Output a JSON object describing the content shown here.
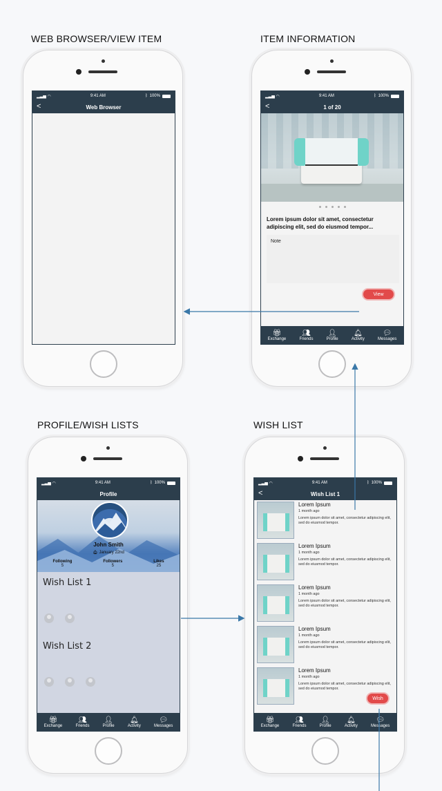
{
  "labels": {
    "browser": "WEB BROWSER/VIEW ITEM",
    "item_info": "ITEM INFORMATION",
    "profile": "PROFILE/WISH LISTS",
    "wish_list": "WISH LIST"
  },
  "status": {
    "time": "9:41 AM",
    "battery": "100%"
  },
  "browser_screen": {
    "title": "Web Browser",
    "back": "<"
  },
  "item_screen": {
    "title": "1 of 20",
    "back": "<",
    "description": "Lorem ipsum dolor sit amet, consectetur adipiscing elit, sed do eiusmod tempor...",
    "note_label": "Note",
    "view_label": "View"
  },
  "tabs": [
    {
      "label": "Exchange",
      "icon": "gift-icon"
    },
    {
      "label": "Friends",
      "icon": "friends-icon"
    },
    {
      "label": "Profile",
      "icon": "profile-icon"
    },
    {
      "label": "Activity",
      "icon": "bell-icon"
    },
    {
      "label": "Messages",
      "icon": "message-icon"
    }
  ],
  "profile_screen": {
    "title": "Profile",
    "name": "John Smith",
    "birthday": "January 22nd",
    "stats": [
      {
        "label": "Following",
        "value": "5"
      },
      {
        "label": "Followers",
        "value": "5"
      },
      {
        "label": "Likes",
        "value": "25"
      }
    ],
    "lists": [
      {
        "title": "Wish List 1",
        "friends": 2
      },
      {
        "title": "Wish List 2",
        "friends": 3
      }
    ]
  },
  "wishlist_screen": {
    "title": "Wish List 1",
    "back": "<",
    "wish_label": "Wish",
    "items": [
      {
        "name": "Lorem Ipsum",
        "time": "1 month ago",
        "desc": "Lorem ipsum dolor sit amet, consectetur adipiscing elit, sed do eiusmod tempor."
      },
      {
        "name": "Lorem Ipsum",
        "time": "1 month ago",
        "desc": "Lorem ipsum dolor sit amet, consectetur adipiscing elit, sed do eiusmod tempor."
      },
      {
        "name": "Lorem Ipsum",
        "time": "1 month ago",
        "desc": "Lorem ipsum dolor sit amet, consectetur adipiscing elit, sed do eiusmod tempor."
      },
      {
        "name": "Lorem Ipsum",
        "time": "1 month ago",
        "desc": "Lorem ipsum dolor sit amet, consectetur adipiscing elit, sed do eiusmod tempor."
      },
      {
        "name": "Lorem Ipsum",
        "time": "1 month ago",
        "desc": "Lorem ipsum dolor sit amet, consectetur adipiscing elit, sed do eiusmod tempor."
      }
    ]
  },
  "colors": {
    "header": "#2c3e4c",
    "accent": "#e24a4a",
    "arrow": "#3a78a8"
  }
}
